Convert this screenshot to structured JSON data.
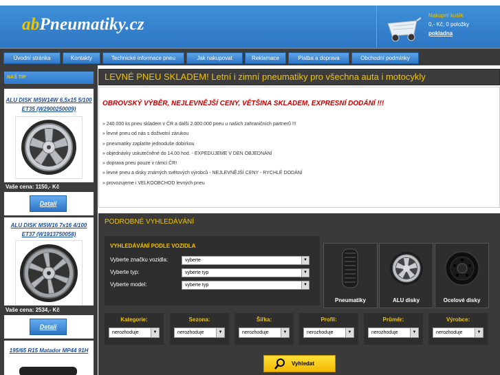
{
  "header": {
    "logo_ab": "ab",
    "logo_main": "Pneumatiky",
    "logo_tld": ".cz",
    "cart_title": "Nakupní košík",
    "cart_summary": "0,- Kč, 0 položky",
    "cart_checkout": "pokladna",
    "cart_icon": "cart-icon",
    "brand_color": "#f2c400"
  },
  "nav": {
    "items": [
      {
        "label": "Úvodní stránka"
      },
      {
        "label": "Kontakty"
      },
      {
        "label": "Technické informace pneu"
      },
      {
        "label": "Jak nakupovat"
      },
      {
        "label": "Reklamace"
      },
      {
        "label": "Platba a doprava"
      },
      {
        "label": "Obchodní podmínky"
      }
    ]
  },
  "sidebar": {
    "tip_title": "NÁŠ TIP",
    "products": [
      {
        "title": "ALU DISK MSW14W 6,5x15 5/100 ET35 (W2900250009)",
        "price": "Vaše cena: 1150,- Kč",
        "detail": "Detail"
      },
      {
        "title": "ALU DISK MSW16 7x16 4/100 ET37 (W1913750058)",
        "price": "Vaše cena: 2534,- Kč",
        "detail": "Detail"
      },
      {
        "title": "195/65 R15 Matador MP44 91H"
      }
    ]
  },
  "main": {
    "banner": "LEVNÉ PNEU SKLADEM! Letní i zimní pneumatiky pro všechna auta i motocykly",
    "headline": "OBROVSKÝ VÝBĚR, NEJLEVNĚJŠÍ CENY, VĚTŠINA SKLADEM, EXPRESNÍ DODÁNÍ !!!",
    "bullets": [
      "» 240.000 ks pneu skladem v ČR a další 2.000.000 pneu u našich zahraničních partnerů !!!",
      "» levné pneu od nás s doživotní zárukou",
      "» pneumatiky zaplatíte jednoduše dobírkou",
      "» objednávky uskutečněné do 14.00 hod. - EXPEDUJEME V DEN OBJEDNÁNÍ",
      "» doprava pneu pouze v rámci ČR!",
      "» levné pneu a disky známých světových výrobců - NEJLEVNĚJŠÍ CENY - RYCHLÉ DODÁNÍ",
      "» provozujeme i VELKOOBCHOD levných pneu"
    ]
  },
  "search": {
    "title": "PODROBNÉ VYHLEDÁVÁNÍ",
    "vehicle_title": "VYHLEDÁVÁNÍ PODLE VOZIDLA",
    "vehicle_fields": [
      {
        "label": "Vyberte značku vozidla:",
        "value": "vyberte"
      },
      {
        "label": "Vyberte typ:",
        "value": "vyberte typ"
      },
      {
        "label": "Vyberte model:",
        "value": "vyberte typ"
      }
    ],
    "categories": [
      {
        "label": "Pneumatiky",
        "icon": "tire-icon"
      },
      {
        "label": "ALU disky",
        "icon": "alloy-wheel-icon"
      },
      {
        "label": "Ocelové disky",
        "icon": "steel-wheel-icon"
      }
    ],
    "filters": [
      {
        "label": "Kategorie:",
        "value": "nerozhoduje"
      },
      {
        "label": "Sezona:",
        "value": "nerozhoduje"
      },
      {
        "label": "Šířka:",
        "value": "nerozhoduje"
      },
      {
        "label": "Profil:",
        "value": "nerozhoduje"
      },
      {
        "label": "Průměr:",
        "value": "nerozhoduje"
      },
      {
        "label": "Výrobce:",
        "value": "nerozhoduje"
      }
    ],
    "button": "Vyhledat",
    "button_icon": "search-icon"
  }
}
